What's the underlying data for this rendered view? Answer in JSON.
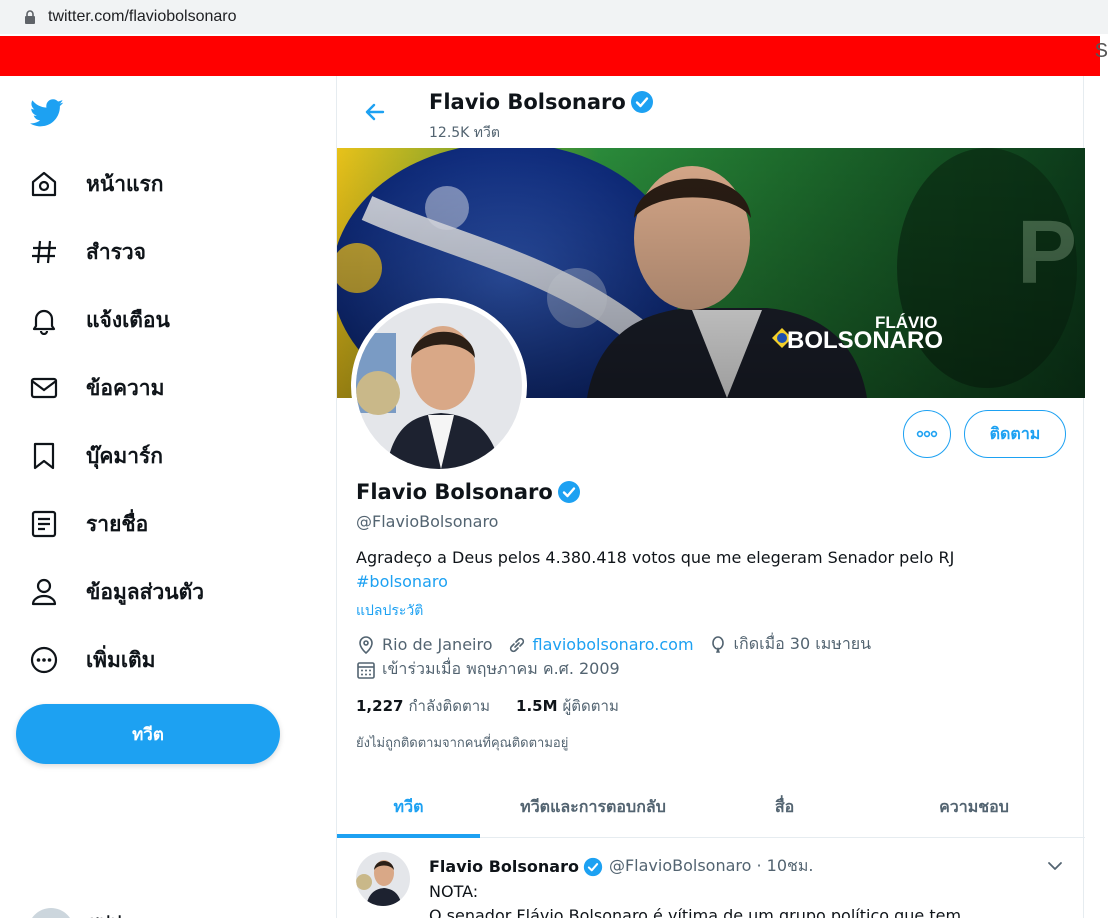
{
  "browser": {
    "url": "twitter.com/flaviobolsonaro",
    "edge_char": "S"
  },
  "sidebar": {
    "items": [
      {
        "label": "หน้าแรก",
        "icon": "home-icon"
      },
      {
        "label": "สำรวจ",
        "icon": "hashtag-icon"
      },
      {
        "label": "แจ้งเตือน",
        "icon": "bell-icon"
      },
      {
        "label": "ข้อความ",
        "icon": "mail-icon"
      },
      {
        "label": "บุ๊คมาร์ก",
        "icon": "bookmark-icon"
      },
      {
        "label": "รายชื่อ",
        "icon": "list-icon"
      },
      {
        "label": "ข้อมูลส่วนตัว",
        "icon": "profile-icon"
      },
      {
        "label": "เพิ่มเติม",
        "icon": "more-circle-icon"
      }
    ],
    "tweet_button": "ทวีต",
    "account_stub": "ชฟฟ"
  },
  "header": {
    "name": "Flavio Bolsonaro",
    "tweet_count": "12.5K ทวีต"
  },
  "banner": {
    "text_top": "FLÁVIO",
    "text_bottom": "BOLSONARO"
  },
  "profile": {
    "follow_label": "ติดตาม",
    "more_label": "ooo",
    "name": "Flavio Bolsonaro",
    "handle": "@FlavioBolsonaro",
    "bio": "Agradeço a Deus pelos 4.380.418 votos que me elegeram Senador pelo RJ",
    "hashtag": "#bolsonaro",
    "translate": "แปลประวัติ",
    "location": "Rio de Janeiro",
    "website": "flaviobolsonaro.com",
    "birthday": "เกิดเมื่อ 30 เมษายน",
    "joined": "เข้าร่วมเมื่อ พฤษภาคม ค.ศ. 2009",
    "following_count": "1,227",
    "following_label": "กำลังติดตาม",
    "followers_count": "1.5M",
    "followers_label": "ผู้ติดตาม",
    "not_followed_note": "ยังไม่ถูกติดตามจากคนที่คุณติดตามอยู่"
  },
  "tabs": [
    {
      "label": "ทวีต"
    },
    {
      "label": "ทวีตและการตอบกลับ"
    },
    {
      "label": "สื่อ"
    },
    {
      "label": "ความชอบ"
    }
  ],
  "tweet": {
    "name": "Flavio Bolsonaro",
    "handle": "@FlavioBolsonaro · 10ชม.",
    "line1": "NOTA:",
    "line2": "O senador Flávio Bolsonaro é vítima de um grupo político que tem"
  },
  "colors": {
    "accent": "#1da1f2",
    "red_bar": "#ff0000",
    "text": "#0f1419",
    "muted": "#536471"
  }
}
